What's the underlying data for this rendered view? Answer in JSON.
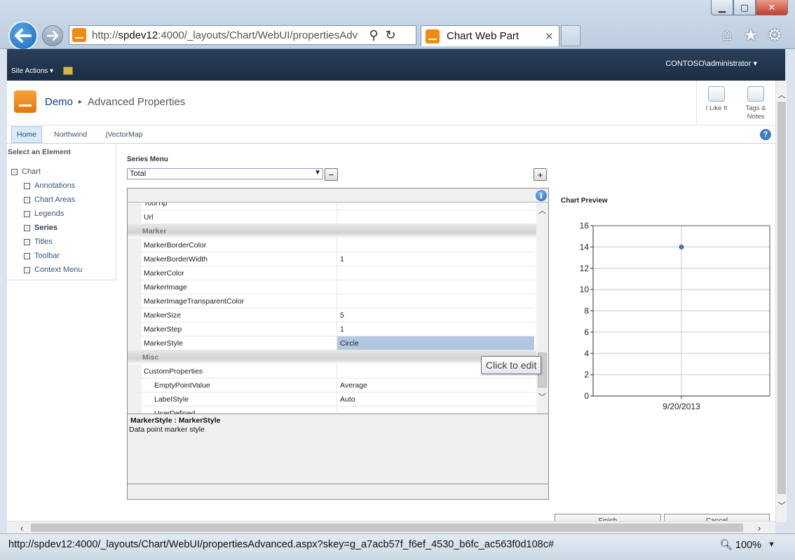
{
  "browser": {
    "address_prefix": "http://",
    "address_host": "spdev12",
    "address_rest": ":4000/_layouts/Chart/WebUI/propertiesAdv",
    "tab_title": "Chart Web Part",
    "tab_close": "✕"
  },
  "ribbon": {
    "site_actions": "Site Actions",
    "user": "CONTOSO\\administrator"
  },
  "titlebar": {
    "site_link": "Demo",
    "current_page": "Advanced Properties",
    "like_label_1": "I Like It",
    "tags_label_1": "Tags &",
    "tags_label_2": "Notes"
  },
  "topnav": [
    "Home",
    "Northwind",
    "jVectorMap"
  ],
  "left_nav": {
    "title": "Select an Element",
    "root": "Chart",
    "items": [
      "Annotations",
      "Chart Areas",
      "Legends",
      "Series",
      "Titles",
      "Toolbar",
      "Context Menu"
    ]
  },
  "series_menu": {
    "label": "Series Menu",
    "selected": "Total",
    "remove_label": "−",
    "add_label": "+"
  },
  "property_grid": {
    "rows": [
      {
        "type": "prop",
        "name": "ToolTip",
        "value": ""
      },
      {
        "type": "prop",
        "name": "Url",
        "value": ""
      },
      {
        "type": "cat",
        "name": "Marker"
      },
      {
        "type": "prop",
        "name": "MarkerBorderColor",
        "value": ""
      },
      {
        "type": "prop",
        "name": "MarkerBorderWidth",
        "value": "1"
      },
      {
        "type": "prop",
        "name": "MarkerColor",
        "value": ""
      },
      {
        "type": "prop",
        "name": "MarkerImage",
        "value": ""
      },
      {
        "type": "prop",
        "name": "MarkerImageTransparentColor",
        "value": ""
      },
      {
        "type": "prop",
        "name": "MarkerSize",
        "value": "5"
      },
      {
        "type": "prop",
        "name": "MarkerStep",
        "value": "1"
      },
      {
        "type": "prop",
        "name": "MarkerStyle",
        "value": "Circle",
        "selected": true
      },
      {
        "type": "cat",
        "name": "Misc"
      },
      {
        "type": "prop",
        "name": "CustomProperties",
        "value": ""
      },
      {
        "type": "sub",
        "name": "EmptyPointValue",
        "value": "Average"
      },
      {
        "type": "sub",
        "name": "LabelStyle",
        "value": "Auto"
      },
      {
        "type": "sub",
        "name": "UserDefined",
        "value": ""
      }
    ],
    "description_title": "MarkerStyle : MarkerStyle",
    "description_text": "Data point marker style",
    "tooltip": "Click to edit"
  },
  "chart_preview": {
    "title": "Chart Preview"
  },
  "chart_data": {
    "type": "line",
    "categories": [
      "9/20/2013"
    ],
    "series": [
      {
        "values": [
          14
        ]
      }
    ],
    "ylim": [
      0,
      16
    ],
    "yticks": [
      0,
      2,
      4,
      6,
      8,
      10,
      12,
      14,
      16
    ],
    "grid": true,
    "color": "#4a7ab5"
  },
  "buttons": {
    "finish": "Finish",
    "cancel": "Cancel"
  },
  "status": {
    "url": "http://spdev12:4000/_layouts/Chart/WebUI/propertiesAdvanced.aspx?skey=g_a7acb57f_f6ef_4530_b6fc_ac563f0d108c#",
    "zoom": "100%"
  }
}
